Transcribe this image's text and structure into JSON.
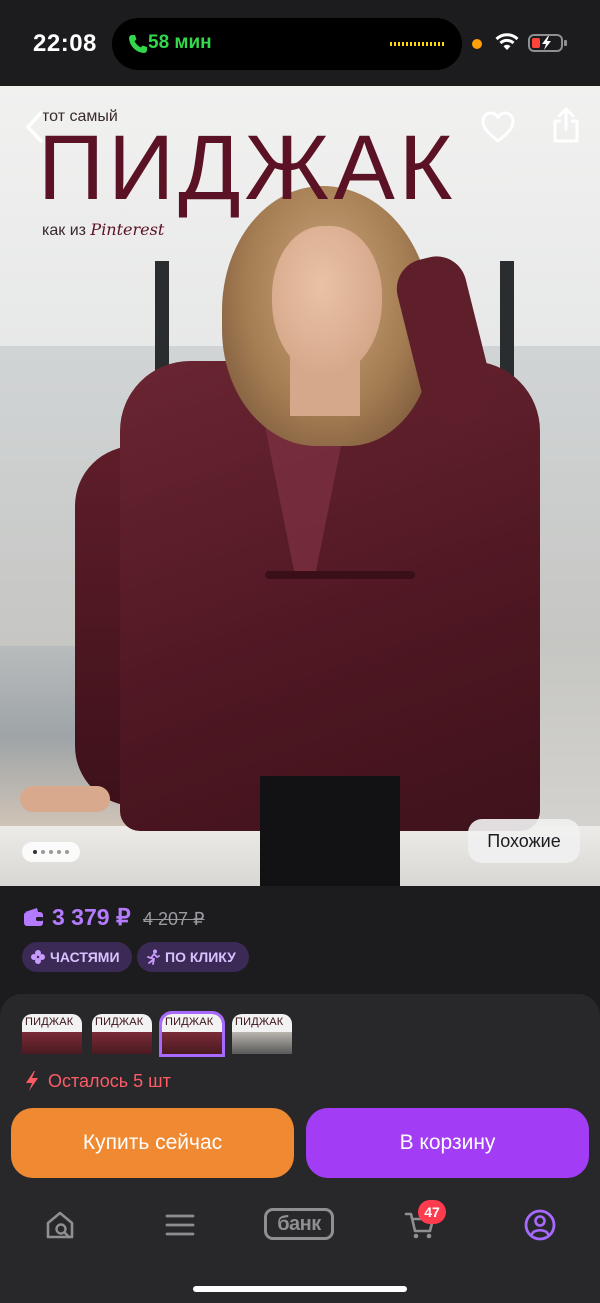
{
  "status_bar": {
    "time": "22:08",
    "call_duration": "58 мин",
    "icons": [
      "phone-icon",
      "wifi-icon",
      "battery-charging-icon"
    ],
    "accent_green": "#32d74b"
  },
  "hero": {
    "headline_small": "тот самый",
    "headline_big": "ПИДЖАК",
    "headline_sub_prefix": "как из",
    "headline_sub_brand": "Pinterest",
    "similar_button": "Похожие",
    "pager": {
      "count": 5,
      "active": 0
    },
    "icons": [
      "back-chevron-icon",
      "heart-icon",
      "share-icon"
    ]
  },
  "price": {
    "current": "3 379 ₽",
    "old": "4 207 ₽",
    "badges": [
      "ЧАСТЯМИ",
      "ПО КЛИКУ"
    ],
    "price_color": "#b57bff"
  },
  "variants": {
    "thumb_labels": [
      "ПИДЖАК",
      "ПИДЖАК",
      "ПИДЖАК",
      "ПИДЖАК"
    ],
    "selected_index": 2
  },
  "stock": {
    "text": "Осталось 5 шт"
  },
  "actions": {
    "buy_now": "Купить сейчас",
    "add_to_cart": "В корзину",
    "buy_color": "#f08a32",
    "cart_color": "#a23cf5"
  },
  "nav": {
    "items": [
      "home-search-icon",
      "menu-icon",
      "bank-logo",
      "cart-icon",
      "profile-icon"
    ],
    "bank_label": "банк",
    "cart_count": "47",
    "active_index": 4
  }
}
